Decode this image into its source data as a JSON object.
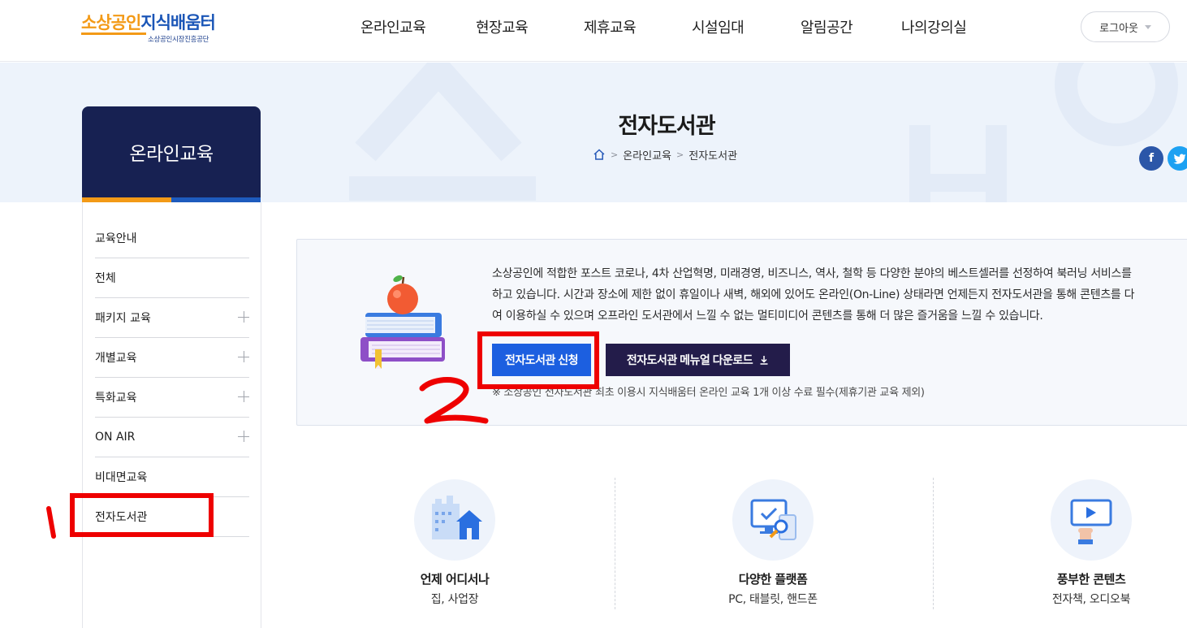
{
  "header": {
    "logo_text_a": "소상공인",
    "logo_text_b": "지식배움터",
    "logo_sub": "소상공인시장진흥공단",
    "nav": [
      {
        "label": "온라인교육"
      },
      {
        "label": "현장교육"
      },
      {
        "label": "제휴교육"
      },
      {
        "label": "시설임대"
      },
      {
        "label": "알림공간"
      },
      {
        "label": "나의강의실"
      }
    ],
    "logout_label": "로그아웃"
  },
  "hero": {
    "title": "전자도서관",
    "breadcrumb": [
      "온라인교육",
      "전자도서관"
    ],
    "social_fb": "f",
    "social_tw": "t"
  },
  "sidebar": {
    "title": "온라인교육",
    "items": [
      {
        "label": "교육안내",
        "expandable": false
      },
      {
        "label": "전체",
        "expandable": false
      },
      {
        "label": "패키지 교육",
        "expandable": true
      },
      {
        "label": "개별교육",
        "expandable": true
      },
      {
        "label": "특화교육",
        "expandable": true
      },
      {
        "label": "ON AIR",
        "expandable": true
      },
      {
        "label": "비대면교육",
        "expandable": false
      },
      {
        "label": "전자도서관",
        "expandable": false
      }
    ]
  },
  "intro": {
    "lines": [
      "소상공인에 적합한 포스트 코로나, 4차 산업혁명, 미래경영, 비즈니스, 역사, 철학 등 다양한 분야의 베스트셀러를 선정하여 북러닝 서비스를",
      "하고 있습니다. 시간과 장소에 제한 없이 휴일이나 새벽, 해외에 있어도 온라인(On-Line) 상태라면 언제든지 전자도서관을 통해 콘텐츠를 다",
      "여 이용하실 수 있으며 오프라인 도서관에서 느낄 수 없는 멀티미디어 콘텐츠를 통해 더 많은 즐거움을 느낄 수 있습니다."
    ],
    "apply_label": "전자도서관 신청",
    "manual_label": "전자도서관 메뉴얼 다운로드",
    "notice": "※ 소상공인 전자도서관 최초 이용시 지식배움터 온라인 교육 1개 이상 수료 필수(제휴기관 교육 제외)"
  },
  "features": [
    {
      "title": "언제 어디서나",
      "desc": "집, 사업장",
      "icon": "building-house-icon"
    },
    {
      "title": "다양한 플랫폼",
      "desc": "PC, 태블릿, 핸드폰",
      "icon": "devices-icon"
    },
    {
      "title": "풍부한 콘텐츠",
      "desc": "전자책, 오디오북",
      "icon": "video-screen-icon"
    }
  ],
  "annotations": {
    "mark_1": "1",
    "mark_2": "2",
    "color": "#ee0000"
  },
  "colors": {
    "sidebar_title_bg": "#172152",
    "accent_orange": "#f39a17",
    "accent_blue": "#1e5bbd",
    "apply_button": "#1c5fe0",
    "manual_button": "#231c4a"
  }
}
